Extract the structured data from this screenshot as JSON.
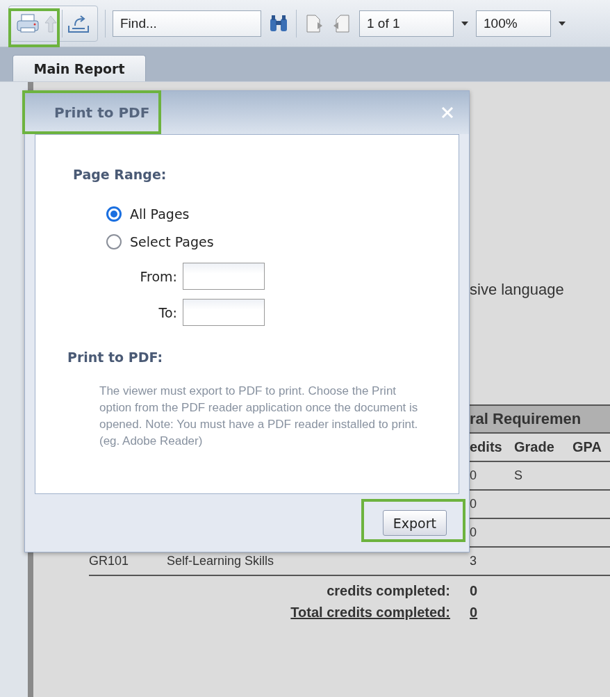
{
  "toolbar": {
    "find": {
      "placeholder": "Find..."
    },
    "page": {
      "value": "1 of 1"
    },
    "zoom": {
      "value": "100%"
    }
  },
  "tabs": [
    {
      "label": "Main Report",
      "selected": true
    }
  ],
  "report": {
    "fragment": "sive language",
    "section_header": "ral Requiremen",
    "columns": [
      "edits",
      "Grade",
      "GPA"
    ],
    "rows": [
      {
        "credits": "0",
        "grade": "S"
      },
      {
        "credits": "0"
      },
      {
        "credits": "0"
      },
      {
        "code": "GR101",
        "title": "Self-Learning Skills",
        "credits": "3"
      }
    ],
    "totals": [
      {
        "label": "credits completed:",
        "value": "0",
        "underlined": false
      },
      {
        "label": "Total credits completed:",
        "value": "0",
        "underlined": true
      }
    ]
  },
  "dialog": {
    "title": "Print to PDF",
    "page_range_label": "Page Range:",
    "options": [
      {
        "label": "All Pages",
        "selected": true
      },
      {
        "label": "Select Pages",
        "selected": false
      }
    ],
    "from_label": "From:",
    "to_label": "To:",
    "print_label": "Print to PDF:",
    "note": "The viewer must export to PDF to print. Choose the Print option from the PDF reader application once the document is opened. Note: You must have a PDF reader installed to print. (eg. Adobe Reader)",
    "export_button": "Export"
  }
}
